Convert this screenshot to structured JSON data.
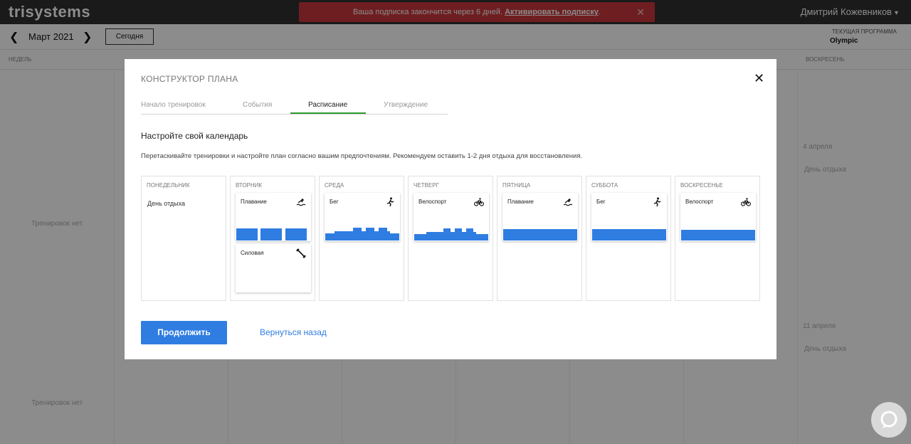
{
  "topbar": {
    "logo": "trisystems",
    "banner_text": "Ваша подписка закончится через 6 дней.",
    "banner_link": "Активировать подписку",
    "banner_dot": ".",
    "close_glyph": "✕",
    "username": "Дмитрий Кожевников",
    "banner_color": "#c8383c"
  },
  "datebar": {
    "prev_glyph": "❮",
    "next_glyph": "❯",
    "month": "Март 2021",
    "today": "Сегодня",
    "program_label": "ТЕКУЩАЯ ПРОГРАММА",
    "program_name": "Olympic"
  },
  "week_header": {
    "first": "НЕДЕЛЬ",
    "last": "ВОСКРЕСЕНЬ"
  },
  "background": {
    "no_workouts_1": "Тренировок нет",
    "no_workouts_2": "Тренировок нет",
    "date_1": "4 апреля",
    "rest_1": "День отдыха",
    "date_2": "11 апреля",
    "rest_2": "День отдыха"
  },
  "modal": {
    "title": "КОНСТРУКТОР ПЛАНА",
    "close_glyph": "✕",
    "steps": [
      {
        "label": "Начало тренировок",
        "active": false
      },
      {
        "label": "События",
        "active": false
      },
      {
        "label": "Расписание",
        "active": true
      },
      {
        "label": "Утверждение",
        "active": false
      }
    ],
    "heading": "Настройте свой календарь",
    "description": "Перетаскивайте тренировки и настройте план согласно вашим предпочтениям. Рекомендуем оставить 1-2 дня отдыха для восстановления.",
    "days": [
      {
        "name": "ПОНЕДЕЛЬНИК",
        "rest": "День отдыха"
      },
      {
        "name": "ВТОРНИК",
        "workouts": [
          {
            "title": "Плавание",
            "icon": "swim-icon"
          },
          {
            "title": "Силовая",
            "icon": "strength-icon"
          }
        ]
      },
      {
        "name": "СРЕДА",
        "workouts": [
          {
            "title": "Бег",
            "icon": "run-icon"
          }
        ]
      },
      {
        "name": "ЧЕТВЕРГ",
        "workouts": [
          {
            "title": "Велоспорт",
            "icon": "bike-icon"
          }
        ]
      },
      {
        "name": "ПЯТНИЦА",
        "workouts": [
          {
            "title": "Плавание",
            "icon": "swim-icon"
          }
        ]
      },
      {
        "name": "СУББОТА",
        "workouts": [
          {
            "title": "Бег",
            "icon": "run-icon"
          }
        ]
      },
      {
        "name": "ВОСКРЕСЕНЬЕ",
        "workouts": [
          {
            "title": "Велоспорт",
            "icon": "bike-icon"
          }
        ]
      }
    ],
    "continue": "Продолжить",
    "back": "Вернуться назад",
    "accent_color": "#2f7de1",
    "step_active_color": "#2f9e30"
  },
  "chat": {
    "icon": "chat-icon"
  }
}
